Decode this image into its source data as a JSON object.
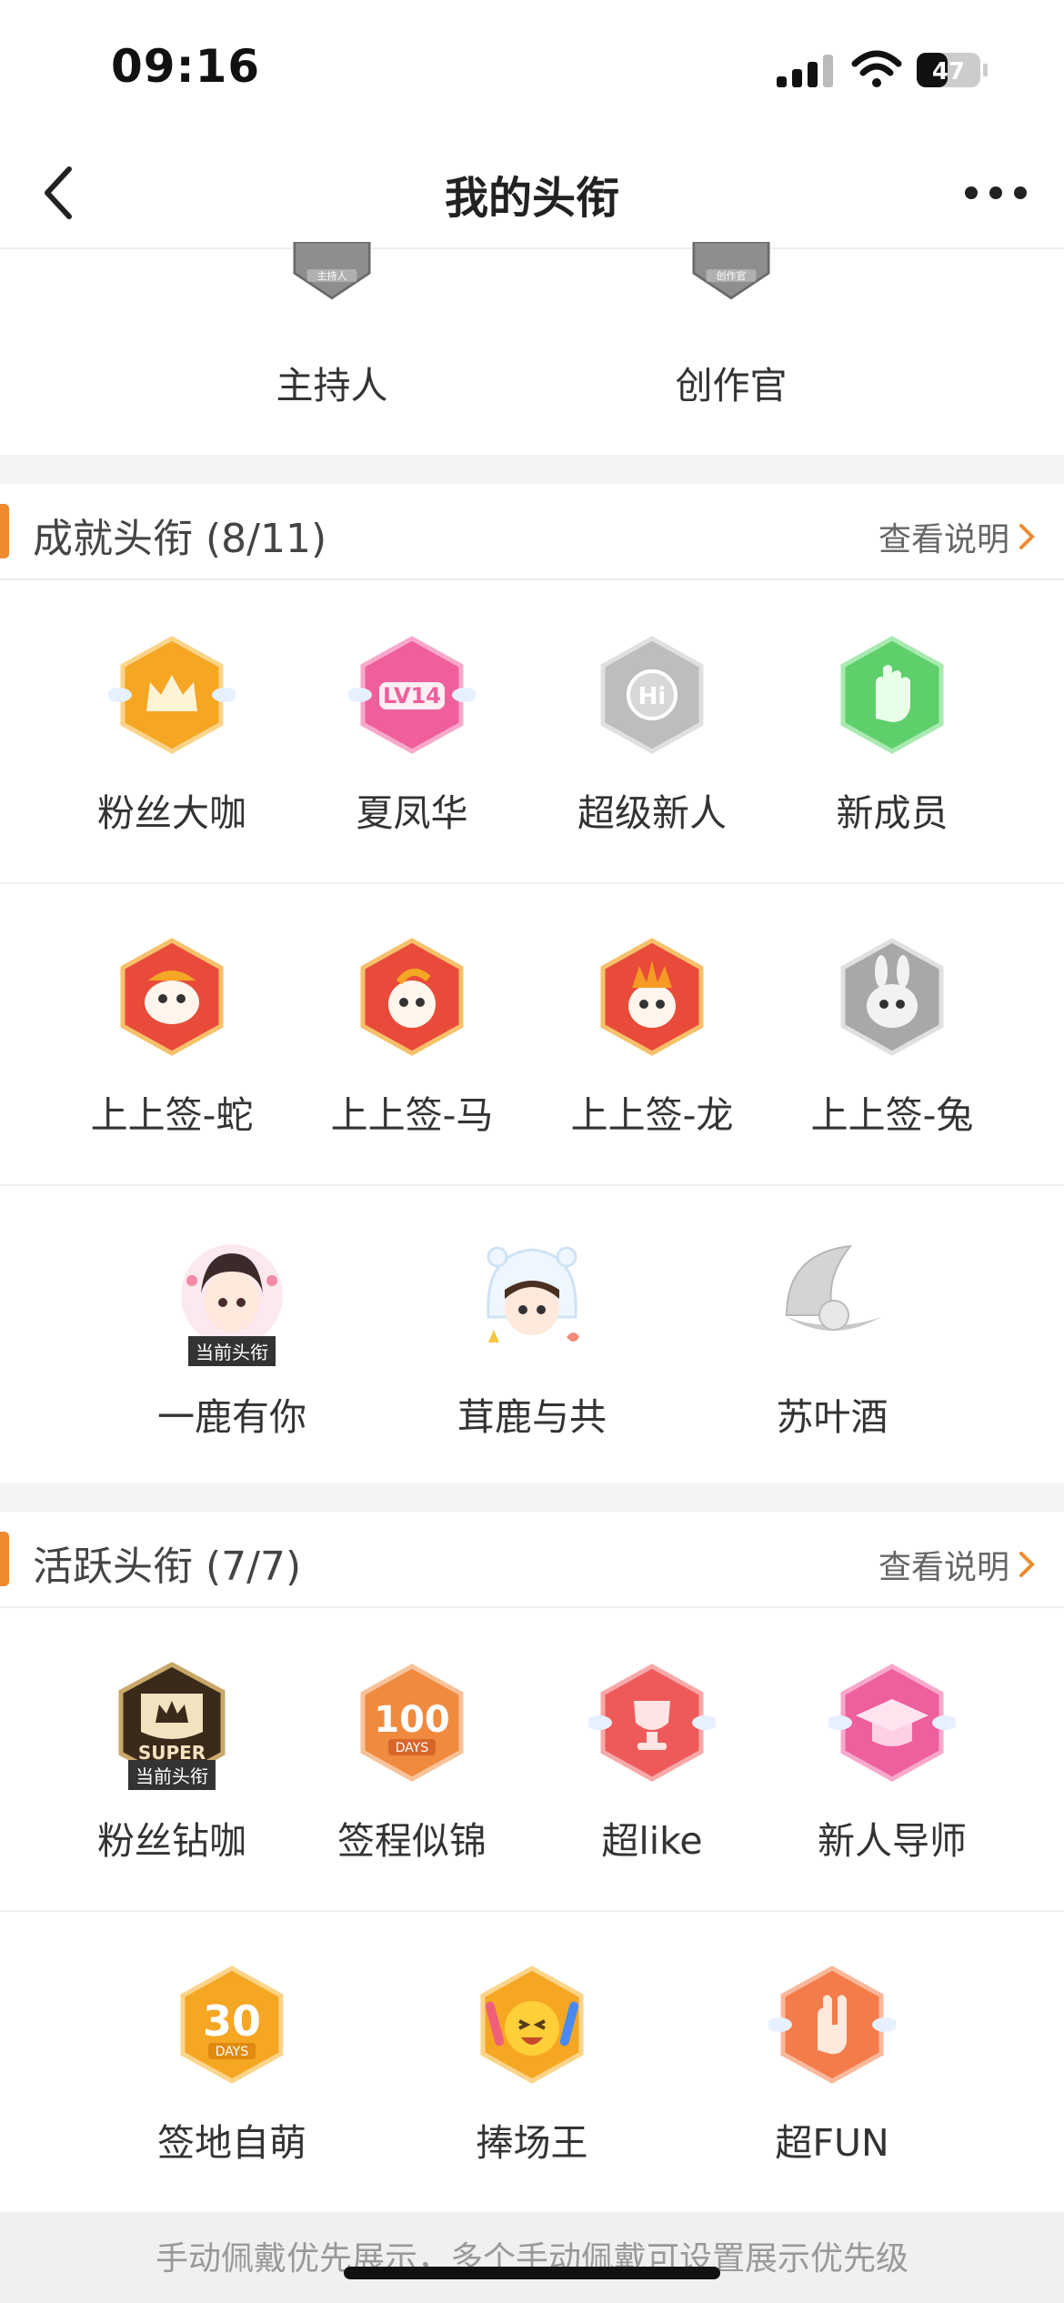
{
  "status": {
    "time": "09:16",
    "battery": "47"
  },
  "nav": {
    "title": "我的头衔"
  },
  "top_badges": [
    {
      "label": "主持人",
      "icon": "host-badge-icon",
      "tag": "主持人"
    },
    {
      "label": "创作官",
      "icon": "creator-badge-icon",
      "tag": "创作官"
    }
  ],
  "achievement": {
    "title": "成就头衔 (8/11)",
    "see_more": "查看说明",
    "rows": [
      [
        {
          "label": "粉丝大咖",
          "icon": "crown-wings-icon",
          "color": "#f5a623"
        },
        {
          "label": "夏凤华",
          "icon": "lv14-icon",
          "color": "#ef5f9c",
          "text": "LV14"
        },
        {
          "label": "超级新人",
          "icon": "hi-icon",
          "color": "#bdbdbd",
          "text": "Hi"
        },
        {
          "label": "新成员",
          "icon": "wave-hand-icon",
          "color": "#5fcf6b"
        }
      ],
      [
        {
          "label": "上上签-蛇",
          "icon": "snake-sign-icon",
          "color": "#e84b3a"
        },
        {
          "label": "上上签-马",
          "icon": "horse-sign-icon",
          "color": "#e84b3a"
        },
        {
          "label": "上上签-龙",
          "icon": "dragon-sign-icon",
          "color": "#e84b3a"
        },
        {
          "label": "上上签-兔",
          "icon": "rabbit-sign-icon",
          "color": "#a8a8a8"
        }
      ],
      [
        {
          "label": "一鹿有你",
          "icon": "girl-avatar-icon",
          "tag": "当前头衔"
        },
        {
          "label": "茸鹿与共",
          "icon": "bear-hood-girl-icon"
        },
        {
          "label": "苏叶酒",
          "icon": "pearl-shell-icon"
        }
      ]
    ]
  },
  "active": {
    "title": "活跃头衔 (7/7)",
    "see_more": "查看说明",
    "rows": [
      [
        {
          "label": "粉丝钻咖",
          "icon": "super-crown-icon",
          "color": "#3a2a1a",
          "text": "SUPER",
          "tag": "当前头衔"
        },
        {
          "label": "签程似锦",
          "icon": "100-days-icon",
          "color": "#f08a3e",
          "text": "100",
          "sub": "DAYS"
        },
        {
          "label": "超like",
          "icon": "trophy-icon",
          "color": "#ee5a5a"
        },
        {
          "label": "新人导师",
          "icon": "grad-cap-icon",
          "color": "#ee5f9e"
        }
      ],
      [
        {
          "label": "签地自萌",
          "icon": "30-days-icon",
          "color": "#f5a623",
          "text": "30",
          "sub": "DAYS"
        },
        {
          "label": "捧场王",
          "icon": "cheer-face-icon",
          "color": "#f5a623"
        },
        {
          "label": "超FUN",
          "icon": "rock-hand-icon",
          "color": "#f47b4a"
        }
      ]
    ]
  },
  "footer": {
    "text": "手动佩戴优先展示，多个手动佩戴可设置展示优先级"
  }
}
